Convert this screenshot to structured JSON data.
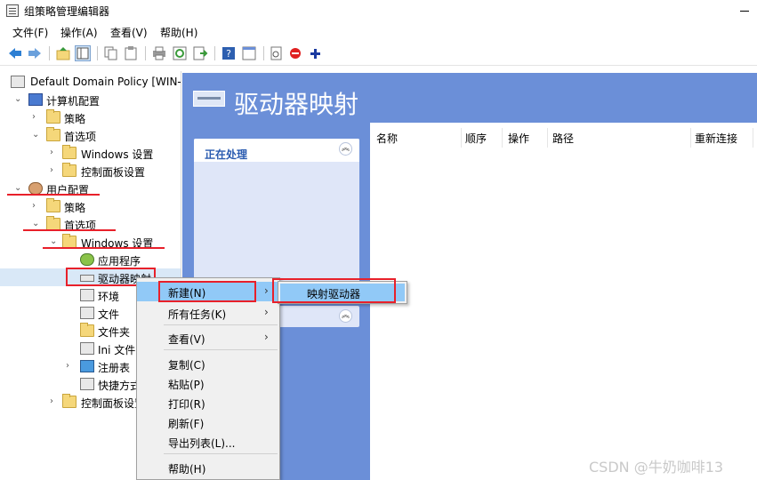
{
  "window": {
    "title": "组策略管理编辑器"
  },
  "menubar": [
    "文件(F)",
    "操作(A)",
    "查看(V)",
    "帮助(H)"
  ],
  "toolbar_icons": [
    "back-arrow-icon",
    "forward-arrow-icon",
    "up-folder-icon",
    "show-tree-icon",
    "copy-icon",
    "paste-icon",
    "print-icon",
    "refresh-icon",
    "export-icon",
    "help-icon",
    "properties-icon",
    "document-icon",
    "stop-icon",
    "add-icon"
  ],
  "tree": {
    "root": "Default Domain Policy [WIN-",
    "computer_config": "计算机配置",
    "c_policy": "策略",
    "c_prefs": "首选项",
    "c_windows": "Windows 设置",
    "c_controlpanel": "控制面板设置",
    "user_config": "用户配置",
    "u_policy": "策略",
    "u_prefs": "首选项",
    "u_windows": "Windows 设置",
    "u_apps": "应用程序",
    "u_drivemaps": "驱动器映射",
    "u_env": "环境",
    "u_files": "文件",
    "u_folders": "文件夹",
    "u_ini": "Ini 文件",
    "u_registry": "注册表",
    "u_shortcuts": "快捷方式",
    "u_controlpanel": "控制面板设置"
  },
  "main": {
    "header_title": "驱动器映射",
    "task_card_title": "正在处理",
    "columns": [
      "名称",
      "顺序",
      "操作",
      "路径",
      "重新连接"
    ]
  },
  "context_menu": {
    "items": [
      "新建(N)",
      "所有任务(K)",
      "查看(V)",
      "复制(C)",
      "粘贴(P)",
      "打印(R)",
      "刷新(F)",
      "导出列表(L)...",
      "帮助(H)"
    ]
  },
  "submenu": {
    "item": "映射驱动器"
  },
  "watermark": "CSDN @牛奶咖啡13",
  "colors": {
    "accent_blue": "#6b8fd8",
    "highlight": "#91c9f7",
    "annotation_red": "#e8202a"
  }
}
